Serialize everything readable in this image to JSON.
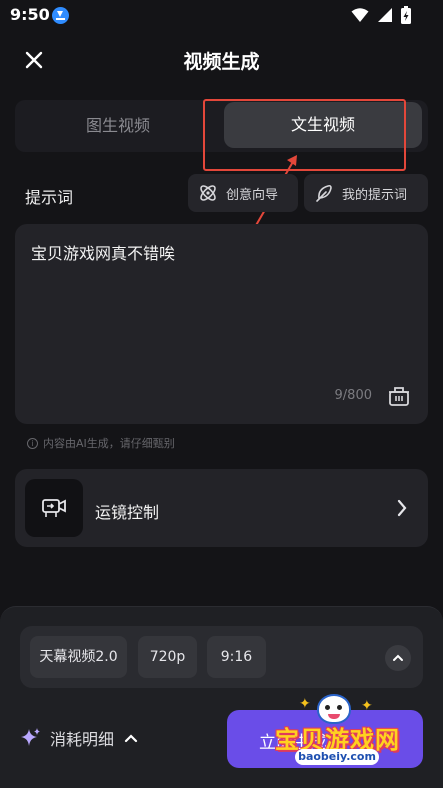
{
  "status_bar": {
    "time": "9:50",
    "icons": [
      "download-icon",
      "wifi-icon",
      "signal-icon",
      "battery-charging-icon"
    ]
  },
  "header": {
    "title": "视频生成",
    "close_icon": "close-icon"
  },
  "tabs": [
    {
      "label": "图生视频",
      "active": false
    },
    {
      "label": "文生视频",
      "active": true
    }
  ],
  "prompt": {
    "section_label": "提示词",
    "creative_guide_label": "创意向导",
    "my_prompts_label": "我的提示词",
    "value": "宝贝游戏网真不错唉",
    "counter": "9/800"
  },
  "ai_note": {
    "icon": "i",
    "text": "内容由AI生成，请仔细甄别"
  },
  "camera_control": {
    "label": "运镜控制"
  },
  "params": {
    "model": "天幕视频2.0",
    "resolution": "720p",
    "ratio": "9:16"
  },
  "footer": {
    "cost_label": "消耗明细",
    "generate_label": "立即生成"
  },
  "watermark": {
    "brand": "宝贝游戏网",
    "url": "baobeiy.com"
  },
  "colors": {
    "background": "#141417",
    "accent": "#6a4de8",
    "highlight": "#e3473a"
  }
}
